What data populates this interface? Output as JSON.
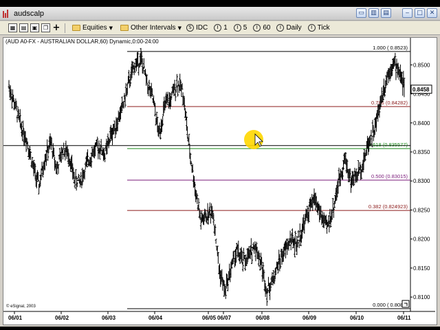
{
  "window": {
    "title": "audscalp"
  },
  "titlebar_icons": [
    "restore-icon",
    "chart-icon",
    "properties-icon",
    "minimize-icon",
    "maximize-icon",
    "close-icon"
  ],
  "titlebar_glyphs": [
    "▭",
    "▥",
    "▤",
    "‒",
    "□",
    "✕"
  ],
  "toolbar": {
    "equities_label": "Equities",
    "other_intervals_label": "Other Intervals",
    "intervals": [
      {
        "icon": "S",
        "label": "IDC"
      },
      {
        "icon": "I",
        "label": "1"
      },
      {
        "icon": "I",
        "label": "5"
      },
      {
        "icon": "I",
        "label": "60"
      },
      {
        "icon": "I",
        "label": "Daily"
      },
      {
        "icon": "I",
        "label": "Tick"
      }
    ]
  },
  "chart_header": "(AUD A0-FX - AUSTRALIAN DOLLAR,60) Dynamic,0:00-24:00",
  "copyright": "© eSignal, 2003",
  "colors": {
    "fib_100": "#000000",
    "fib_786": "#8b1a1a",
    "fib_618": "#1a8a1a",
    "fib_500": "#7a1a7a",
    "fib_382": "#8b1a1a",
    "fib_0": "#000000",
    "horizontal_line": "#000000",
    "highlight": "#ffd700"
  },
  "chart_data": {
    "type": "line",
    "description_series": "AUD/USD 60-minute OHLC bars",
    "x_labels": [
      "06/01",
      "06/02",
      "06/03",
      "06/04",
      "06/05",
      "06/07",
      "06/08",
      "06/09",
      "06/10",
      "06/11"
    ],
    "y_ticks": [
      "0.8500",
      "0.8450",
      "0.8400",
      "0.8350",
      "0.8300",
      "0.8250",
      "0.8200",
      "0.8150",
      "0.8100"
    ],
    "ylim": [
      0.808,
      0.853
    ],
    "last_price": "0.8458",
    "series": [
      {
        "values": [
          0.8463,
          0.843,
          0.8395,
          0.837,
          0.8325,
          0.829,
          0.834,
          0.8365,
          0.832,
          0.8355,
          0.8345,
          0.83,
          0.83,
          0.833,
          0.835,
          0.836,
          0.8345,
          0.838,
          0.84,
          0.843,
          0.847,
          0.85,
          0.851,
          0.847,
          0.844,
          0.838,
          0.843,
          0.844,
          0.847,
          0.8455,
          0.836,
          0.829,
          0.823,
          0.824,
          0.825,
          0.815,
          0.811,
          0.815,
          0.818,
          0.816,
          0.817,
          0.819,
          0.816,
          0.811,
          0.813,
          0.816,
          0.818,
          0.82,
          0.819,
          0.822,
          0.825,
          0.827,
          0.824,
          0.822,
          0.825,
          0.83,
          0.834,
          0.83,
          0.831,
          0.833,
          0.837,
          0.839,
          0.844,
          0.848,
          0.8505,
          0.849,
          0.846
        ]
      }
    ]
  },
  "fib_levels": [
    {
      "label": "1.000  ( 0.8523)",
      "price": 0.8523,
      "color_key": "fib_100",
      "name": "fib-level-100"
    },
    {
      "label": "0.786  (0.84282)",
      "price": 0.84282,
      "color_key": "fib_786",
      "name": "fib-level-786"
    },
    {
      "label": "0.618  (0.835577)",
      "price": 0.835577,
      "color_key": "fib_618",
      "name": "fib-level-618"
    },
    {
      "label": "0.500  (0.83015)",
      "price": 0.83015,
      "color_key": "fib_500",
      "name": "fib-level-500"
    },
    {
      "label": "0.382  (0.824923)",
      "price": 0.824923,
      "color_key": "fib_382",
      "name": "fib-level-382"
    },
    {
      "label": "0.000  ( 0.8080)",
      "price": 0.808,
      "color_key": "fib_0",
      "name": "fib-level-0"
    }
  ],
  "horizontal_line_price": 0.8361
}
